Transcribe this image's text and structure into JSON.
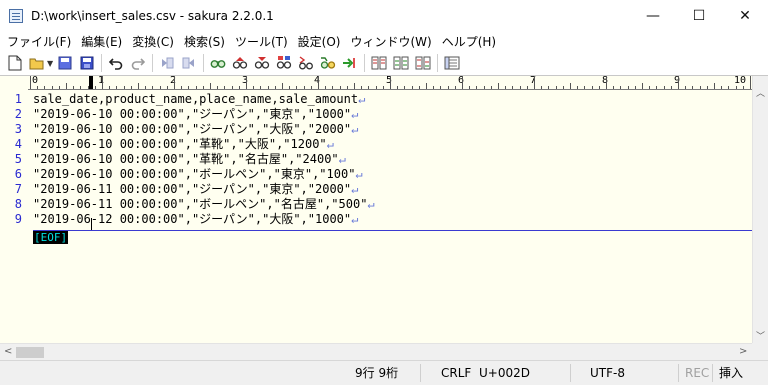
{
  "window": {
    "title": "D:\\work\\insert_sales.csv - sakura 2.2.0.1",
    "minimize": "—",
    "maximize": "☐",
    "close": "✕"
  },
  "menu": [
    "ファイル(F)",
    "編集(E)",
    "変換(C)",
    "検索(S)",
    "ツール(T)",
    "設定(O)",
    "ウィンドウ(W)",
    "ヘルプ(H)"
  ],
  "toolbar": {
    "icons": [
      "new-file-icon",
      "open-file-icon",
      "save-icon",
      "save-all-icon",
      "undo-icon",
      "redo-icon",
      "back-icon",
      "forward-icon",
      "find-icon",
      "find-next-icon",
      "find-prev-icon",
      "replace-icon",
      "grep-icon",
      "bookmark-icon",
      "jump-icon",
      "compare-icon",
      "window-list-icon",
      "tile-icon",
      "outline-icon"
    ]
  },
  "ruler": {
    "labels": [
      "0",
      "1",
      "2",
      "3",
      "4",
      "5",
      "6",
      "7",
      "8",
      "9",
      "10"
    ]
  },
  "editor": {
    "line_numbers": [
      "1",
      "2",
      "3",
      "4",
      "5",
      "6",
      "7",
      "8",
      "9"
    ],
    "lines": [
      "sale_date,product_name,place_name,sale_amount",
      "\"2019-06-10 00:00:00\",\"ジーパン\",\"東京\",\"1000\"",
      "\"2019-06-10 00:00:00\",\"ジーパン\",\"大阪\",\"2000\"",
      "\"2019-06-10 00:00:00\",\"革靴\",\"大阪\",\"1200\"",
      "\"2019-06-10 00:00:00\",\"革靴\",\"名古屋\",\"2400\"",
      "\"2019-06-10 00:00:00\",\"ボールペン\",\"東京\",\"100\"",
      "\"2019-06-11 00:00:00\",\"ジーパン\",\"東京\",\"2000\"",
      "\"2019-06-11 00:00:00\",\"ボールペン\",\"名古屋\",\"500\"",
      "\"2019-06-12 00:00:00\",\"ジーパン\",\"大阪\",\"1000\""
    ],
    "line_end_mark": "↵",
    "eof_mark": "[EOF]"
  },
  "status": {
    "position": "9行  9桁",
    "line_ending": "CRLF",
    "char_code": "U+002D",
    "encoding": "UTF-8",
    "rec": "REC",
    "mode": "挿入"
  }
}
